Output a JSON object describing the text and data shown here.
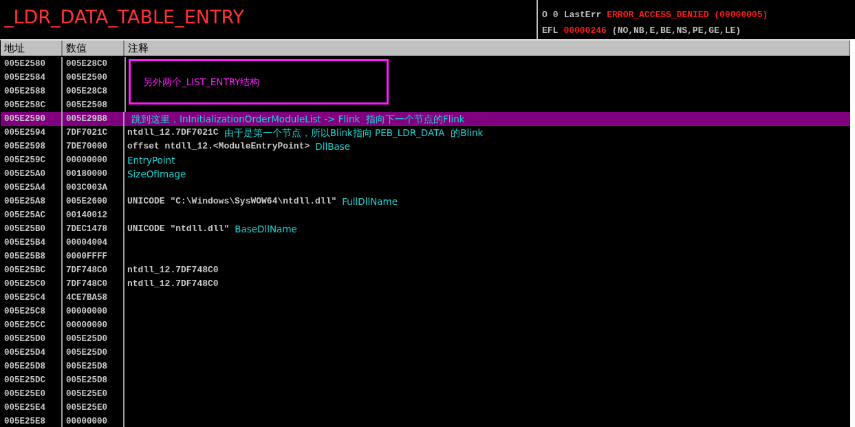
{
  "title": "_LDR_DATA_TABLE_ENTRY",
  "registers": [
    {
      "name": "O",
      "value": "0",
      "label": "LastErr",
      "detail": "ERROR_ACCESS_DENIED (00000005)"
    },
    {
      "name": "EFL",
      "value": "00000246",
      "detail": "(NO,NB,E,BE,NS,PE,GE,LE)"
    }
  ],
  "table": {
    "columns": [
      "地址",
      "数值",
      "注释"
    ],
    "box_note": "另外两个_LIST_ENTRY结构",
    "rows": [
      {
        "address": "005E2580",
        "value": "005E28C0",
        "selected": false
      },
      {
        "address": "005E2584",
        "value": "005E2500",
        "selected": false
      },
      {
        "address": "005E2588",
        "value": "005E28C8",
        "selected": false
      },
      {
        "address": "005E258C",
        "value": "005E2508",
        "selected": false
      },
      {
        "address": "005E2590",
        "value": "005E29B8",
        "selected": true,
        "note": "跳到这里，InInitializationOrderModuleList -> Flink  指向下一个节点的Flink"
      },
      {
        "address": "005E2594",
        "value": "7DF7021C",
        "selected": false,
        "comment": "ntdll_12.7DF7021C",
        "note": "由于是第一个节点，所以Blink指向 PEB_LDR_DATA  的Blink"
      },
      {
        "address": "005E2598",
        "value": "7DE70000",
        "selected": false,
        "comment": "offset ntdll_12.<ModuleEntryPoint>",
        "note": "DllBase"
      },
      {
        "address": "005E259C",
        "value": "00000000",
        "selected": false,
        "note": "EntryPoint"
      },
      {
        "address": "005E25A0",
        "value": "00180000",
        "selected": false,
        "note": "SizeOfImage"
      },
      {
        "address": "005E25A4",
        "value": "003C003A",
        "selected": false
      },
      {
        "address": "005E25A8",
        "value": "005E2600",
        "selected": false,
        "comment": "UNICODE \"C:\\Windows\\SysWOW64\\ntdll.dll\"",
        "note": "FullDllName"
      },
      {
        "address": "005E25AC",
        "value": "00140012",
        "selected": false
      },
      {
        "address": "005E25B0",
        "value": "7DEC1478",
        "selected": false,
        "comment": "UNICODE \"ntdll.dll\"",
        "note": "BaseDllName"
      },
      {
        "address": "005E25B4",
        "value": "00004004",
        "selected": false
      },
      {
        "address": "005E25B8",
        "value": "0000FFFF",
        "selected": false
      },
      {
        "address": "005E25BC",
        "value": "7DF748C0",
        "selected": false,
        "comment": "ntdll_12.7DF748C0"
      },
      {
        "address": "005E25C0",
        "value": "7DF748C0",
        "selected": false,
        "comment": "ntdll_12.7DF748C0"
      },
      {
        "address": "005E25C4",
        "value": "4CE7BA58",
        "selected": false
      },
      {
        "address": "005E25C8",
        "value": "00000000",
        "selected": false
      },
      {
        "address": "005E25CC",
        "value": "00000000",
        "selected": false
      },
      {
        "address": "005E25D0",
        "value": "005E25D0",
        "selected": false
      },
      {
        "address": "005E25D4",
        "value": "005E25D0",
        "selected": false
      },
      {
        "address": "005E25D8",
        "value": "005E25D8",
        "selected": false
      },
      {
        "address": "005E25DC",
        "value": "005E25D8",
        "selected": false
      },
      {
        "address": "005E25E0",
        "value": "005E25E0",
        "selected": false
      },
      {
        "address": "005E25E4",
        "value": "005E25E0",
        "selected": false
      },
      {
        "address": "005E25E8",
        "value": "00000000",
        "selected": false
      }
    ]
  }
}
